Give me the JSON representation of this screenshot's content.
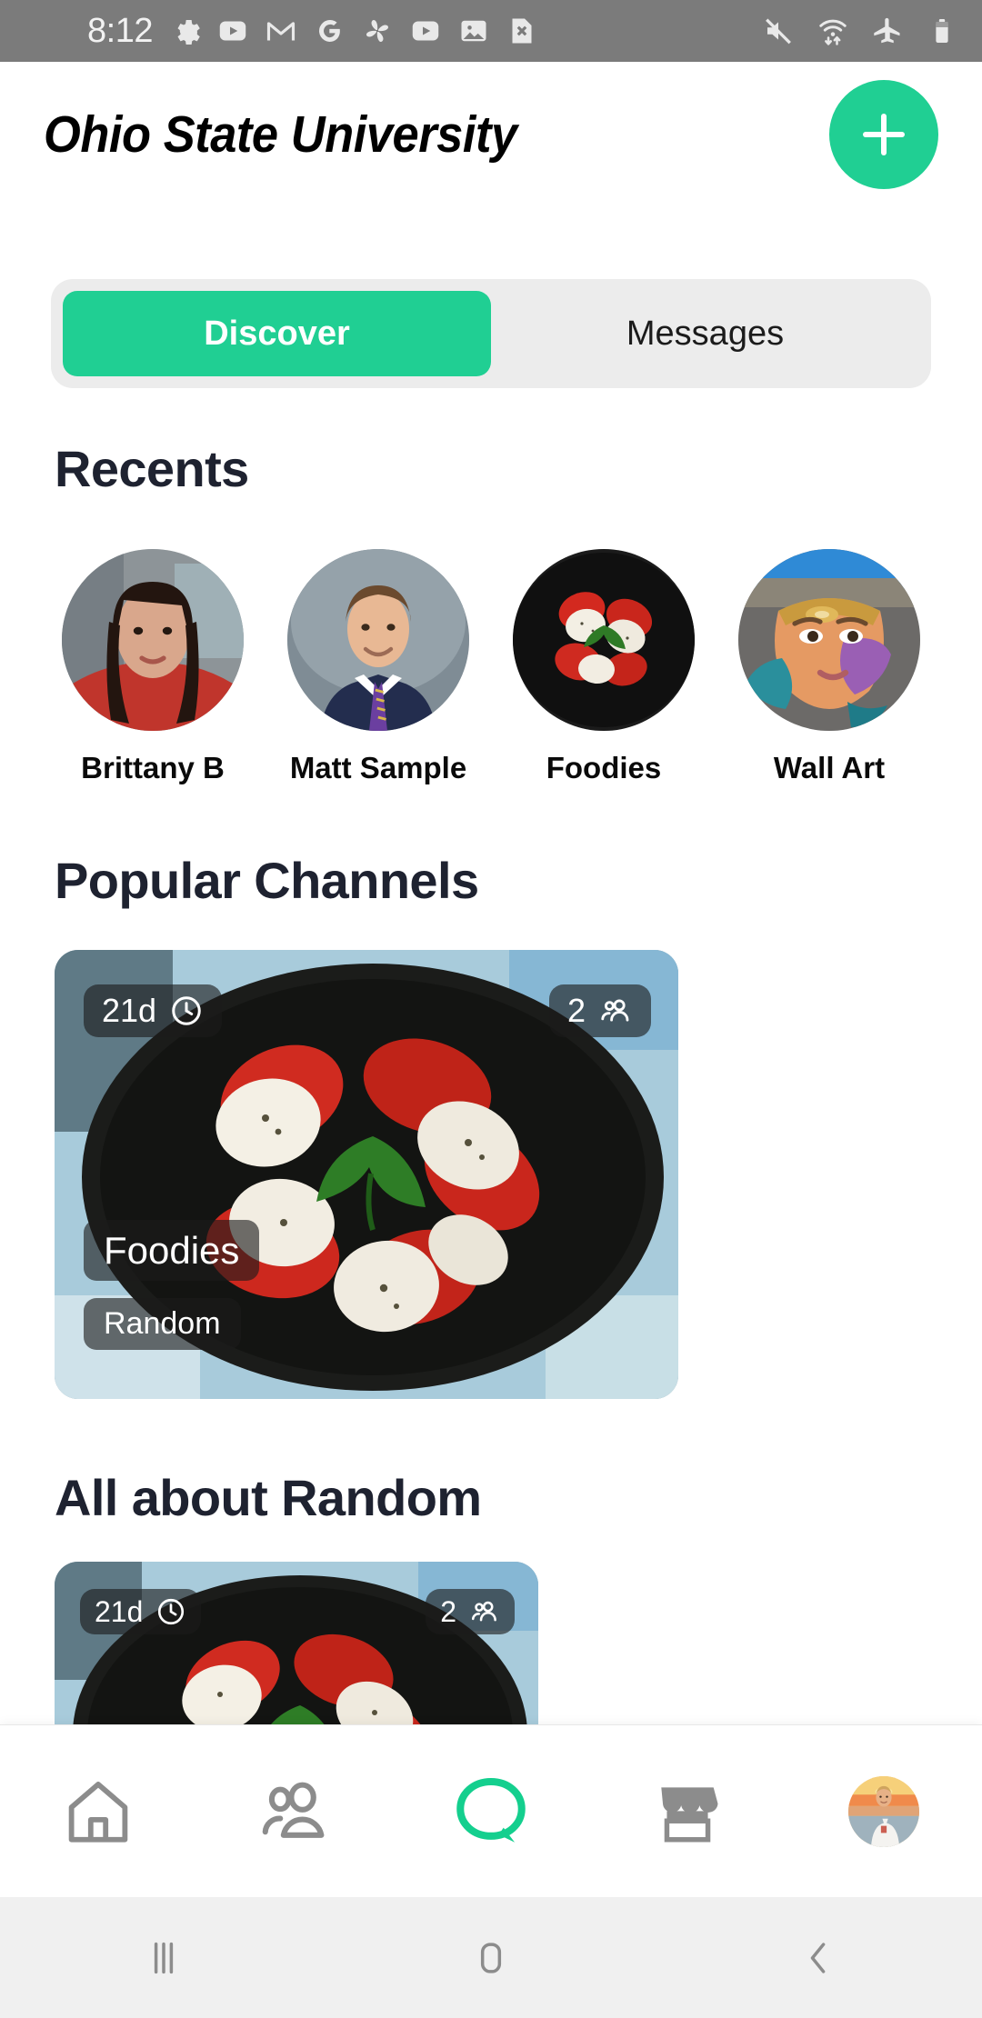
{
  "statusbar": {
    "time": "8:12",
    "left_icons": [
      "gear-icon",
      "youtube-icon",
      "gmail-icon",
      "google-icon",
      "photos-icon",
      "youtube-icon",
      "image-icon",
      "file-x-icon"
    ],
    "right_icons": [
      "mute-icon",
      "wifi-data-icon",
      "airplane-mode-icon",
      "battery-icon"
    ],
    "bg": "#7b7b7b"
  },
  "header": {
    "title": "Ohio State University",
    "add_button": "+",
    "accent": "#20cf93"
  },
  "tabs": {
    "items": [
      {
        "label": "Discover",
        "active": true
      },
      {
        "label": "Messages",
        "active": false
      }
    ]
  },
  "sections": {
    "recents_title": "Recents",
    "popular_title": "Popular Channels",
    "random_title": "All about Random"
  },
  "recents": [
    {
      "name": "Brittany B",
      "avatar": "woman-dark-hair-red-top"
    },
    {
      "name": "Matt Sample",
      "avatar": "man-navy-suit-portrait"
    },
    {
      "name": "Foodies",
      "avatar": "caprese-salad-black-plate"
    },
    {
      "name": "Wall Art",
      "avatar": "street-mural-face"
    }
  ],
  "popular_channels": [
    {
      "title": "Foodies",
      "subtitle": "Random",
      "age": "21d",
      "age_icon": "clock-icon",
      "members": "2",
      "members_icon": "people-icon",
      "image": "caprese-salad-black-plate"
    }
  ],
  "random_channels": [
    {
      "age": "21d",
      "age_icon": "clock-icon",
      "members": "2",
      "members_icon": "people-icon",
      "image": "caprese-salad-black-plate"
    }
  ],
  "bottom_nav": {
    "items": [
      {
        "icon": "home-icon",
        "active": false
      },
      {
        "icon": "people-icon",
        "active": false
      },
      {
        "icon": "chat-icon",
        "active": true
      },
      {
        "icon": "store-icon",
        "active": false
      },
      {
        "icon": "profile-avatar",
        "active": false
      }
    ],
    "active_color": "#14cf8e",
    "inactive_color": "#8c8c8c"
  },
  "system_nav": {
    "items": [
      "recents-button",
      "home-button",
      "back-button"
    ]
  }
}
